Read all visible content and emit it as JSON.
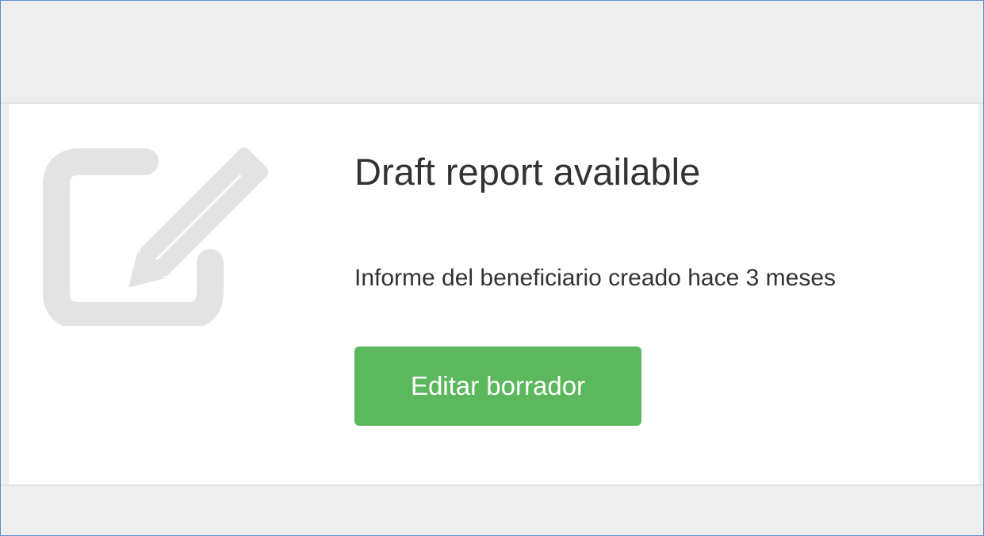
{
  "card": {
    "title": "Draft report available",
    "subtitle": "Informe del beneficiario creado hace 3 meses",
    "button_label": "Editar borrador",
    "icon": "edit-icon"
  },
  "colors": {
    "button_bg": "#5cb85c",
    "icon": "#e3e3e3",
    "background": "#eeeeee",
    "frame_border": "#5b8fd1"
  }
}
